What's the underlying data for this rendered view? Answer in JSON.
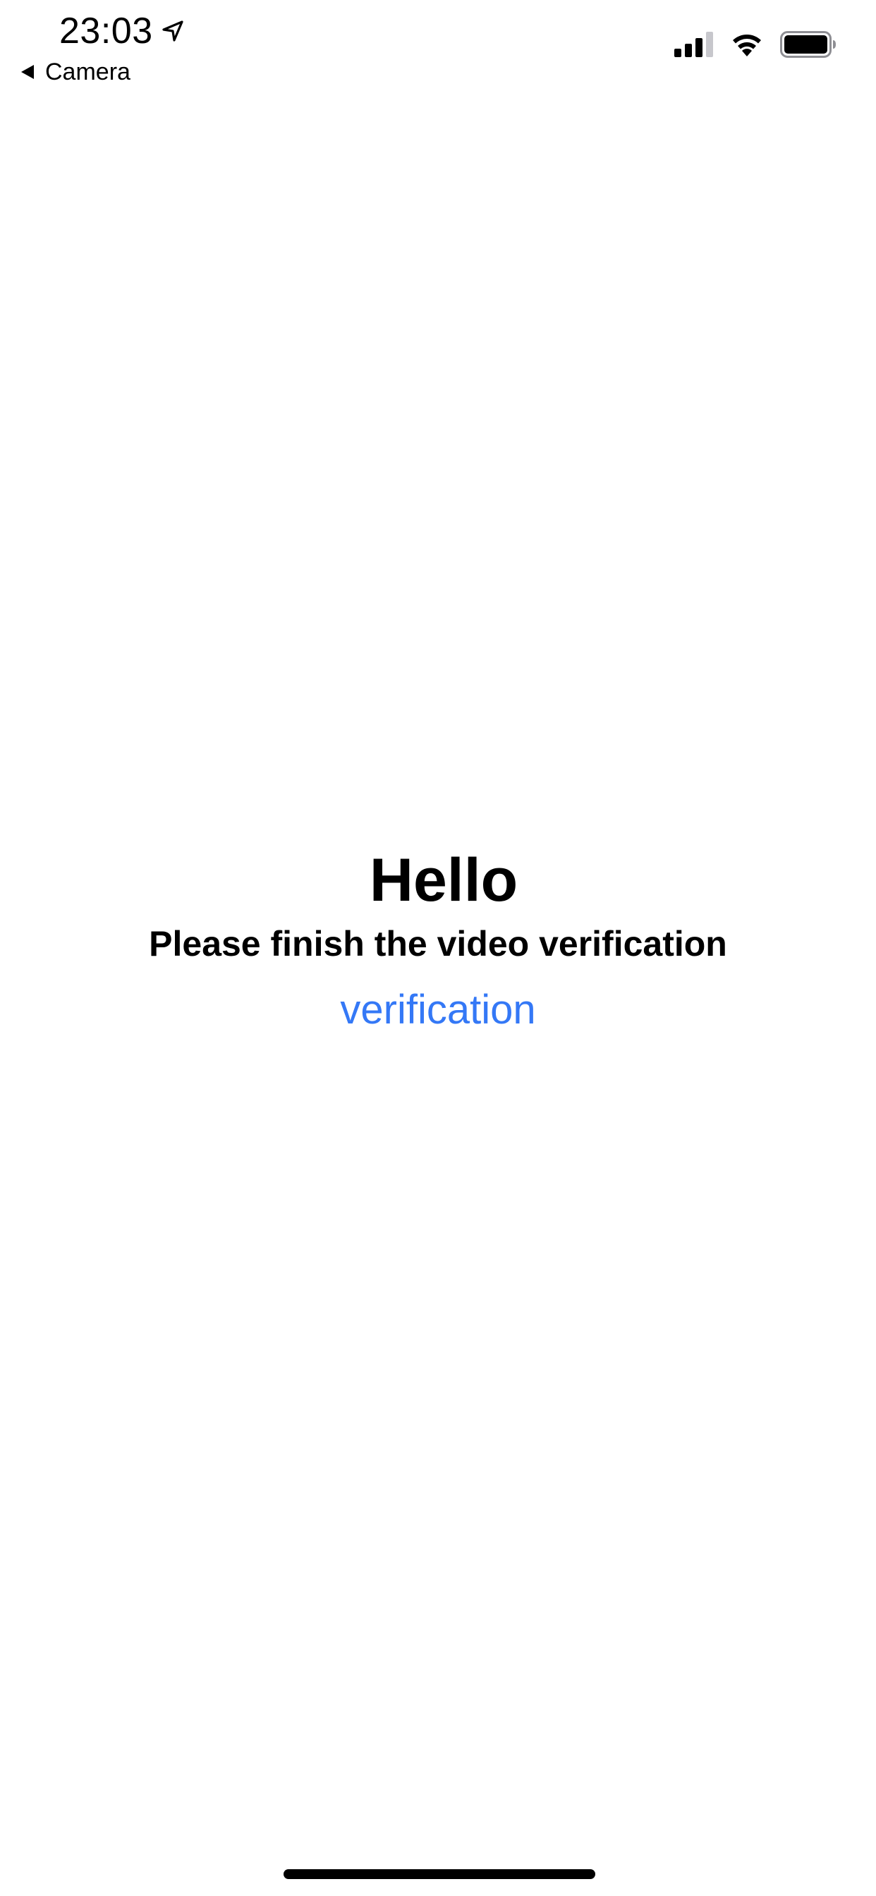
{
  "status_bar": {
    "time": "23:03",
    "back_label": "Camera",
    "icons": [
      "location-arrow-icon",
      "cellular-signal-icon",
      "wifi-icon",
      "battery-icon"
    ]
  },
  "main": {
    "title": "Hello",
    "subtitle": "Please finish the video verification",
    "link_label": "verification"
  },
  "colors": {
    "background": "#ffffff",
    "text": "#000000",
    "link": "#3478f6"
  }
}
